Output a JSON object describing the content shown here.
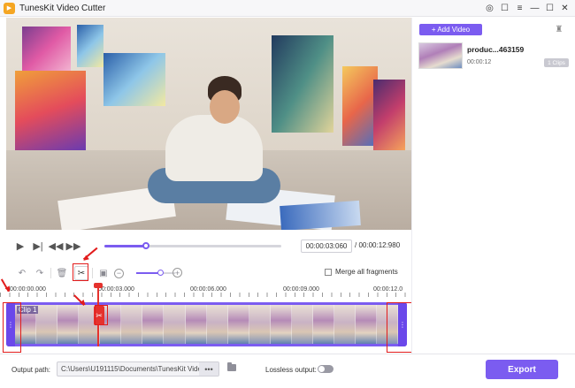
{
  "window": {
    "title": "TunesKit Video Cutter",
    "logo_glyph": "▶",
    "controls": [
      {
        "name": "account-icon",
        "glyph": "◎"
      },
      {
        "name": "feedback-icon",
        "glyph": "☐"
      },
      {
        "name": "menu-icon",
        "glyph": "≡"
      },
      {
        "name": "minimize-icon",
        "glyph": "—"
      },
      {
        "name": "maximize-icon",
        "glyph": "☐"
      },
      {
        "name": "close-icon",
        "glyph": "✕"
      }
    ]
  },
  "playback": {
    "current_time": "00:00:03:060",
    "total_time": "/ 00:00:12:980",
    "progress": 0.235,
    "buttons": [
      "▶",
      "▶|",
      "◀◀",
      "▶▶"
    ]
  },
  "toolbar": {
    "undo": "↶",
    "redo": "↷",
    "delete": "🗑",
    "scissor": "✂",
    "fit": "▣",
    "zoom_out": "−",
    "zoom_in": "+",
    "zoom_level": 0.64,
    "merge_label": "Merge all fragments"
  },
  "ruler": {
    "labels": [
      "00:00:00.000",
      "00:00:03.000",
      "00:00:06.000",
      "00:00:09.000",
      "00:00:12.0"
    ]
  },
  "timeline": {
    "clip_label": "Clip 1",
    "handle_glyph": "⋮",
    "cut_glyph": "✂",
    "thumb_count": 18
  },
  "footer": {
    "output_label": "Output path:",
    "output_path": "C:\\Users\\U191115\\Documents\\TunesKit Vide",
    "browse_dots": "•••",
    "lossless_label": "Lossless output:",
    "export_label": "Export"
  },
  "sidebar": {
    "add_video_label": "+ Add Video",
    "clean_icon": "♜",
    "media": [
      {
        "name": "produc...463159",
        "duration": "00:00:12",
        "clips": "1 Clips"
      }
    ]
  },
  "colors": {
    "accent": "#7b5cf0",
    "annotation": "#e21c1c",
    "playhead": "#e5322d"
  }
}
